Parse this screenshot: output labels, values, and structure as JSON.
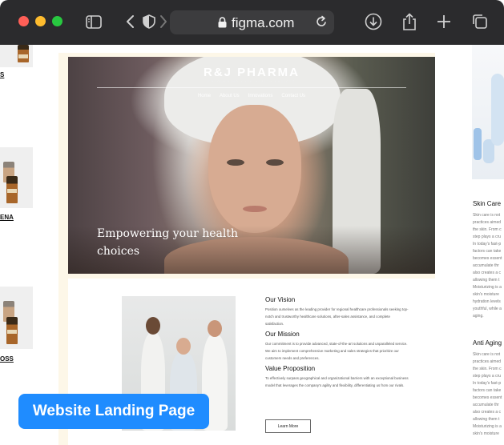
{
  "browser": {
    "url": "figma.com",
    "icons": [
      "sidebar-icon",
      "back-icon",
      "shield-icon",
      "forward-icon",
      "lock-icon",
      "reload-icon",
      "download-icon",
      "share-icon",
      "new-tab-icon",
      "tabs-icon"
    ]
  },
  "left_products": [
    {
      "name": "S"
    },
    {
      "name": "ENA"
    },
    {
      "name": "OSS"
    }
  ],
  "site": {
    "brand": "R&J PHARMA",
    "tagline": "EMPOWERING YOUR HEALTH CHOICES",
    "nav": [
      "Home",
      "About Us",
      "Innovations",
      "Contact Us"
    ],
    "headline": "Empowering your health choices",
    "vision": {
      "title": "Our Vision",
      "text": "Position ourselves as the leading provider for regional healthcare professionals seeking top-notch and trustworthy healthcare solutions, after-sales assistance, and complete satisfaction."
    },
    "mission": {
      "title": "Our Mission",
      "text": "Our commitment is to provide advanced, state-of-the-art solutions and unparalleled service. We aim to implement comprehensive marketing and sales strategies that prioritize our customers needs and preferences."
    },
    "value": {
      "title": "Value Proposition",
      "text": "To effectively surpass geographical and organizational barriers with an exceptional business model that leverages the company's agility and flexibility, differentiating us from our rivals."
    },
    "learn_more": "Learn More"
  },
  "right_strip": {
    "skin_care": {
      "title": "Skin Care",
      "lines": [
        "Skin care is not",
        "practices aimed",
        "the skin. From c",
        "step plays a cru",
        "In today's fast-p",
        "factors can take",
        "becomes essent",
        "accumulate thr",
        "also creates a c",
        "allowing them t",
        "Moisturizing is a",
        "skin's moisture",
        "hydration levels",
        "youthful, while a",
        "aging."
      ]
    },
    "anti_aging": {
      "title": "Anti Aging",
      "lines": [
        "Skin care is not",
        "practices aimed",
        "the skin. From c",
        "step plays a cru",
        "In today's fast-p",
        "factors can take",
        "becomes essent",
        "accumulate thr",
        "also creates a c",
        "allowing them t",
        "Moisturizing is a",
        "skin's moisture"
      ]
    }
  },
  "badge": "Website Landing Page",
  "colors": {
    "chrome": "#2b2b2d",
    "badge": "#1f8cff",
    "frame": "#fdf7e8"
  }
}
